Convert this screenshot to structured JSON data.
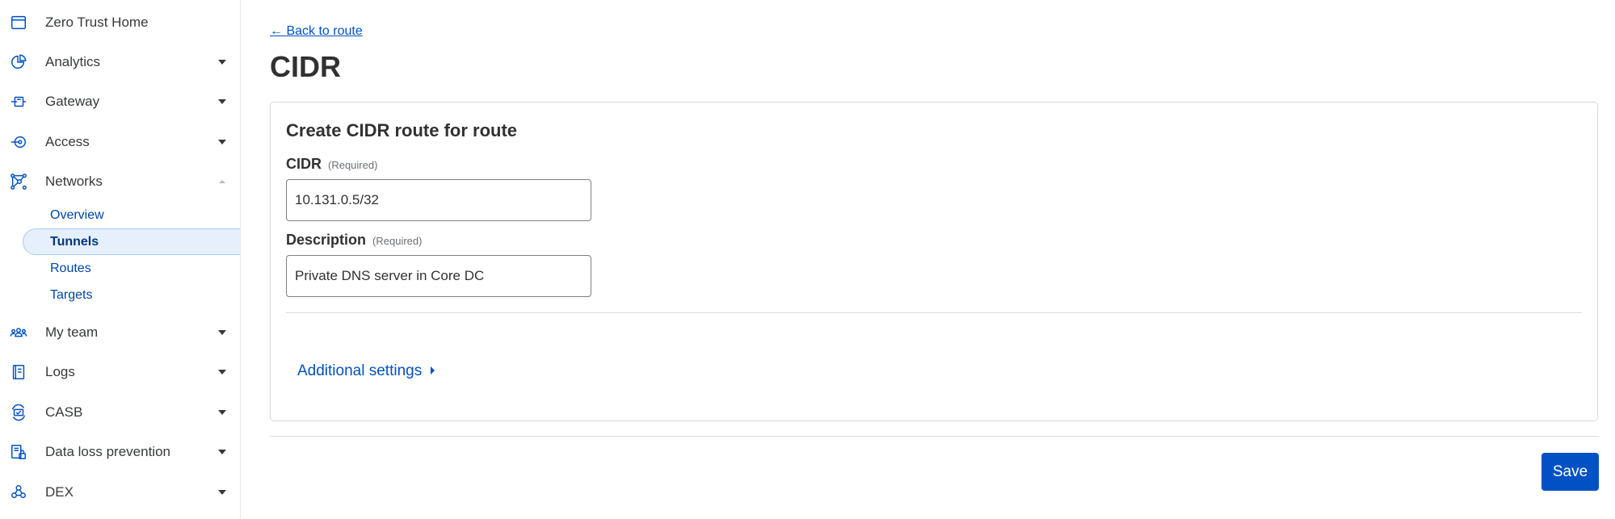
{
  "sidebar": {
    "items": [
      {
        "label": "Zero Trust Home",
        "icon": "home-window-icon"
      },
      {
        "label": "Analytics",
        "icon": "analytics-pie-icon"
      },
      {
        "label": "Gateway",
        "icon": "gateway-icon"
      },
      {
        "label": "Access",
        "icon": "access-icon"
      },
      {
        "label": "Networks",
        "icon": "networks-icon",
        "expanded": true
      },
      {
        "label": "My team",
        "icon": "team-icon"
      },
      {
        "label": "Logs",
        "icon": "logs-icon"
      },
      {
        "label": "CASB",
        "icon": "casb-icon"
      },
      {
        "label": "Data loss prevention",
        "icon": "dlp-icon"
      },
      {
        "label": "DEX",
        "icon": "dex-icon"
      }
    ],
    "networks_sub": [
      {
        "label": "Overview"
      },
      {
        "label": "Tunnels",
        "active": true
      },
      {
        "label": "Routes"
      },
      {
        "label": "Targets"
      }
    ]
  },
  "main": {
    "back_link": "← Back to route",
    "title": "CIDR",
    "card_title": "Create CIDR route for route",
    "cidr": {
      "label": "CIDR",
      "required": "(Required)",
      "value": "10.131.0.5/32"
    },
    "description": {
      "label": "Description",
      "required": "(Required)",
      "value": "Private DNS server in Core DC"
    },
    "additional_settings": "Additional settings",
    "save_label": "Save"
  },
  "colors": {
    "accent": "#0051c3",
    "active_bg": "#e6f0fc"
  }
}
